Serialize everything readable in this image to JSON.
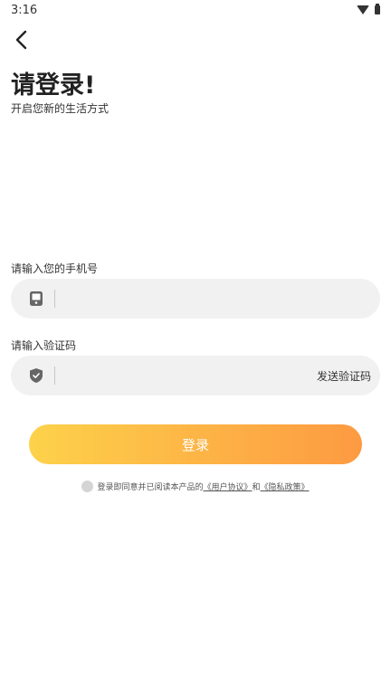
{
  "status_bar": {
    "time": "3:16",
    "icons": [
      "wifi-icon",
      "battery-icon"
    ]
  },
  "header": {
    "back_icon": "chevron-left-icon",
    "title": "请登录!",
    "subtitle": "开启您新的生活方式"
  },
  "phone": {
    "label": "请输入您的手机号",
    "icon": "phone-icon",
    "value": "",
    "placeholder": ""
  },
  "code": {
    "label": "请输入验证码",
    "icon": "shield-icon",
    "value": "",
    "placeholder": "",
    "send_label": "发送验证码"
  },
  "login_button": {
    "label": "登录"
  },
  "agreement": {
    "prefix": "登录即同意并已阅读本产品的",
    "user_agreement": "《用户协议》",
    "and": "和",
    "privacy_policy": "《隐私政策》",
    "checked": false
  },
  "colors": {
    "gradient_start": "#fdd24a",
    "gradient_end": "#fd9a42",
    "field_background": "#f1f1f1"
  }
}
